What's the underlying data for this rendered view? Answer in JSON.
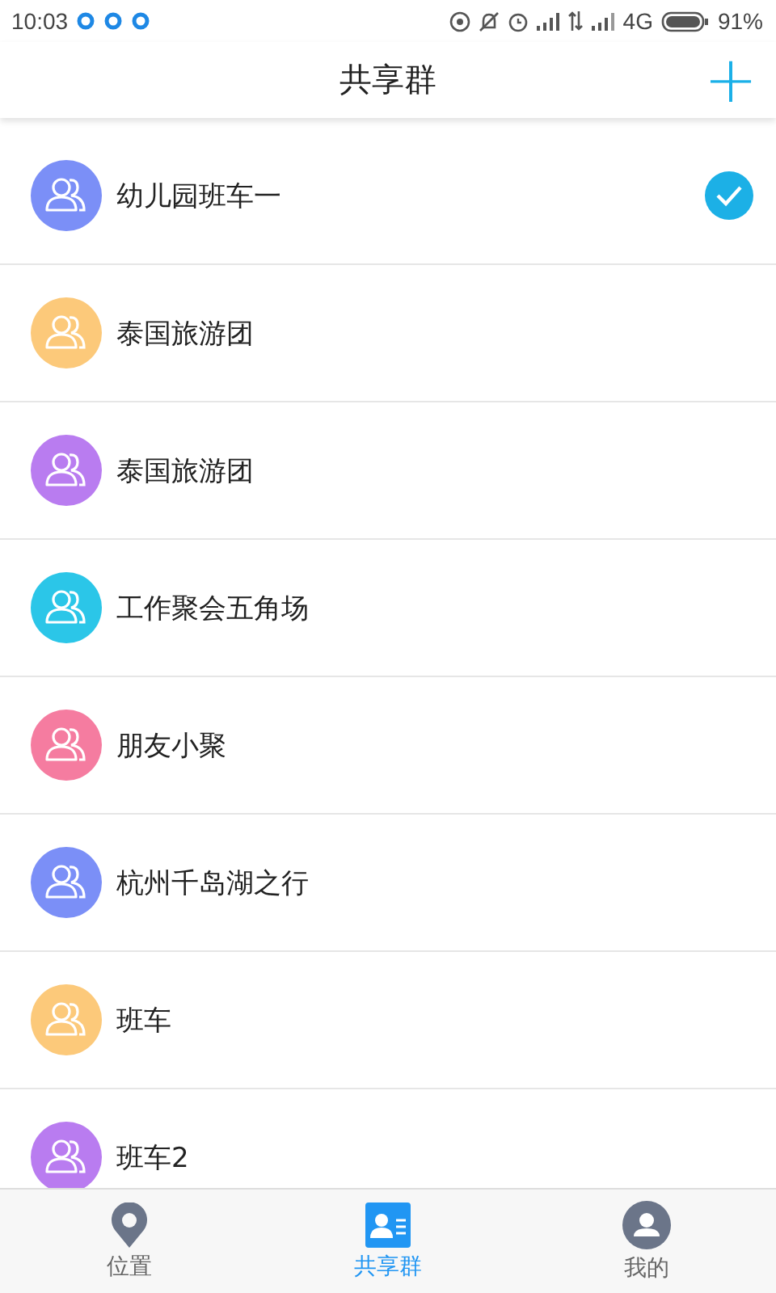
{
  "status_bar": {
    "time": "10:03",
    "network": "4G",
    "battery": "91%"
  },
  "header": {
    "title": "共享群",
    "add_icon": "+"
  },
  "groups": [
    {
      "name": "幼儿园班车一",
      "color": "#7b8ff7",
      "selected": true
    },
    {
      "name": "泰国旅游团",
      "color": "#fcc97a",
      "selected": false
    },
    {
      "name": "泰国旅游团",
      "color": "#b97cf0",
      "selected": false
    },
    {
      "name": "工作聚会五角场",
      "color": "#2bc6e8",
      "selected": false
    },
    {
      "name": "朋友小聚",
      "color": "#f57ca0",
      "selected": false
    },
    {
      "name": "杭州千岛湖之行",
      "color": "#7b8ff7",
      "selected": false
    },
    {
      "name": "班车",
      "color": "#fcc97a",
      "selected": false
    },
    {
      "name": "班车2",
      "color": "#b97cf0",
      "selected": false
    }
  ],
  "tabs": [
    {
      "label": "位置",
      "kind": "location",
      "selected": false
    },
    {
      "label": "共享群",
      "kind": "groups",
      "selected": true
    },
    {
      "label": "我的",
      "kind": "profile",
      "selected": false
    }
  ]
}
